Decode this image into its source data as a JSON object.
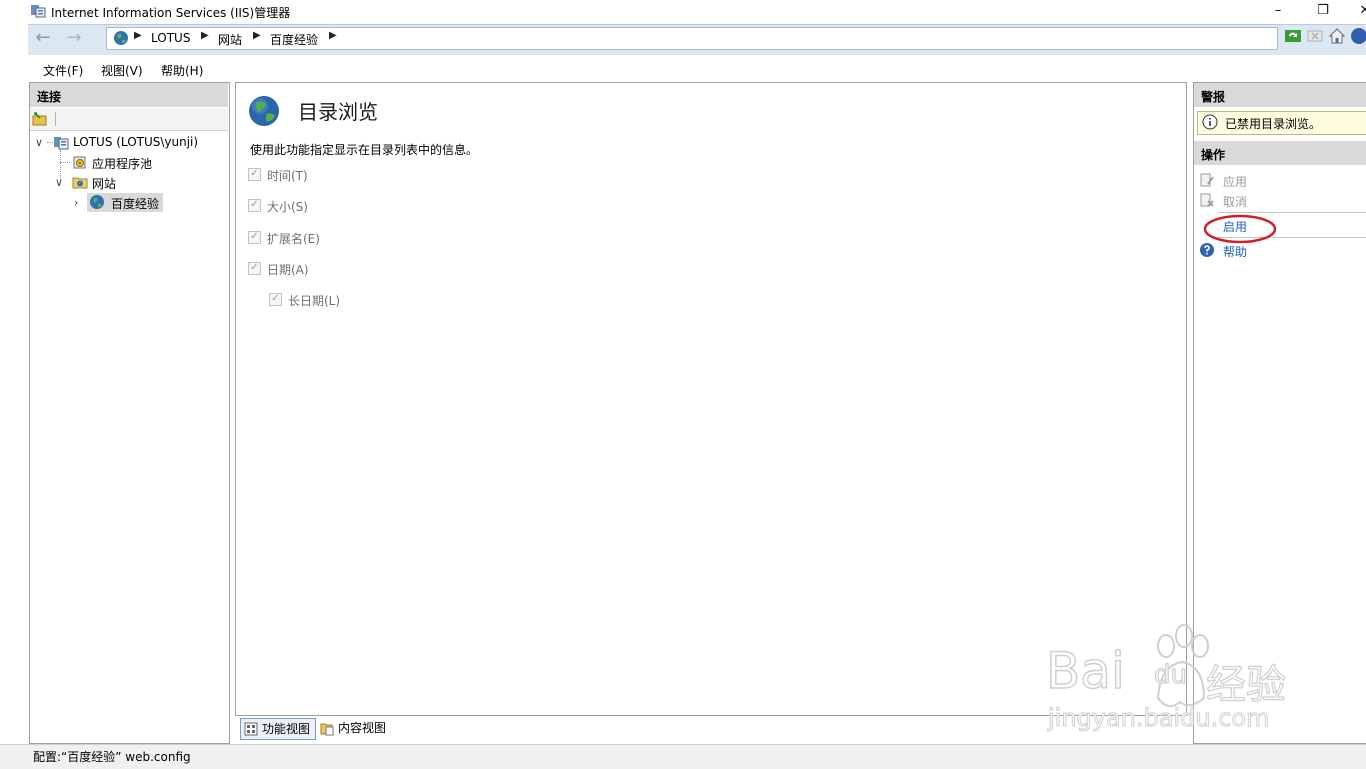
{
  "window": {
    "title": "Internet Information Services (IIS)管理器",
    "minimize": "–",
    "restore": "❐",
    "close": "✕"
  },
  "nav": {
    "breadcrumbs": [
      "LOTUS",
      "网站",
      "百度经验"
    ]
  },
  "menu": {
    "items": [
      "文件(F)",
      "视图(V)",
      "帮助(H)"
    ]
  },
  "connections": {
    "title": "连接",
    "tree": {
      "server": "LOTUS (LOTUS\\yunji)",
      "app_pools": "应用程序池",
      "sites": "网站",
      "site": "百度经验"
    }
  },
  "feature": {
    "title": "目录浏览",
    "description": "使用此功能指定显示在目录列表中的信息。",
    "options": [
      {
        "label": "时间(T)",
        "checked": true
      },
      {
        "label": "大小(S)",
        "checked": true
      },
      {
        "label": "扩展名(E)",
        "checked": true
      },
      {
        "label": "日期(A)",
        "checked": true
      },
      {
        "label": "长日期(L)",
        "checked": true
      }
    ]
  },
  "view_tabs": {
    "features": "功能视图",
    "content": "内容视图"
  },
  "alerts": {
    "title": "警报",
    "message": "已禁用目录浏览。"
  },
  "actions": {
    "title": "操作",
    "apply": "应用",
    "cancel": "取消",
    "enable": "启用",
    "help": "帮助"
  },
  "status": {
    "text": "配置:“百度经验” web.config"
  },
  "watermark": {
    "brand": "Bai",
    "brand2": "du",
    "cn": "经验",
    "url": "jingyan.baidu.com"
  },
  "colors": {
    "nav_bg": "#dbe7f3",
    "header_bg": "#d9d9d9",
    "link": "#1f5fbf",
    "highlight_circle": "#d0202a",
    "alert_bg": "#fffde0"
  }
}
